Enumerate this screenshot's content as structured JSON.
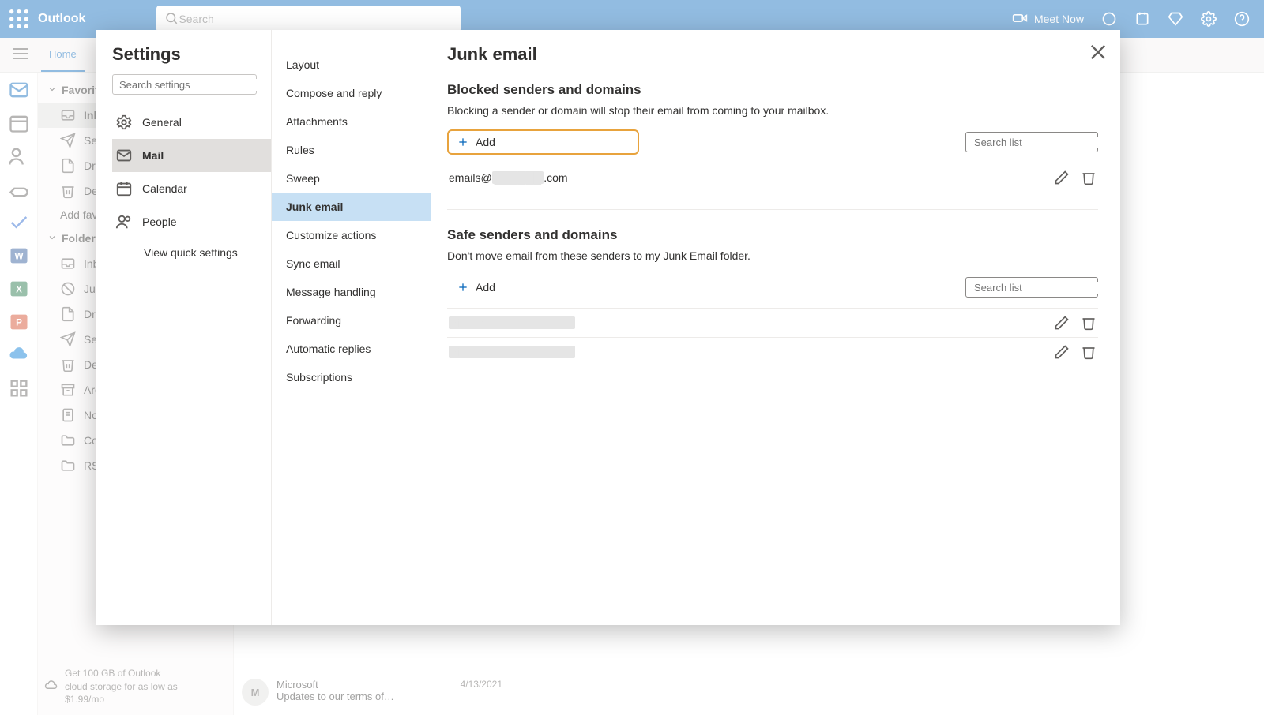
{
  "app": {
    "name": "Outlook"
  },
  "search": {
    "placeholder": "Search"
  },
  "meet": {
    "label": "Meet Now"
  },
  "ribbon": {
    "tabs": [
      "Home"
    ]
  },
  "leftrail": {
    "items": [
      "mail-icon",
      "calendar-icon",
      "people-icon",
      "files-icon",
      "todo-icon",
      "word-icon",
      "excel-icon",
      "powerpoint-icon",
      "onedrive-icon",
      "more-apps-icon"
    ]
  },
  "nav": {
    "sections": {
      "favorites": {
        "label": "Favorites"
      },
      "folders": {
        "label": "Folders"
      }
    },
    "favorites": [
      {
        "name": "inbox",
        "label": "Inbox",
        "icon": "inbox-icon",
        "selected": true
      },
      {
        "name": "sent",
        "label": "Sent Items",
        "icon": "sent-icon"
      },
      {
        "name": "drafts-fav",
        "label": "Drafts",
        "icon": "drafts-icon"
      },
      {
        "name": "deleted-fav",
        "label": "Deleted Items",
        "icon": "trash-icon"
      }
    ],
    "add_favorite": "Add favorite",
    "folders": [
      {
        "name": "inbox-f",
        "label": "Inbox",
        "icon": "inbox-icon"
      },
      {
        "name": "junk",
        "label": "Junk Email",
        "icon": "junk-icon"
      },
      {
        "name": "drafts",
        "label": "Drafts",
        "icon": "drafts-icon"
      },
      {
        "name": "sent-f",
        "label": "Sent Items",
        "icon": "sent-icon"
      },
      {
        "name": "deleted",
        "label": "Deleted Items",
        "icon": "trash-icon"
      },
      {
        "name": "archive",
        "label": "Archive",
        "icon": "archive-icon"
      },
      {
        "name": "notes",
        "label": "Notes",
        "icon": "notes-icon"
      },
      {
        "name": "conv",
        "label": "Conversation History",
        "icon": "folder-icon"
      },
      {
        "name": "feeds",
        "label": "RSS Feeds",
        "icon": "folder-icon"
      }
    ]
  },
  "storage_pitch": {
    "line1": "Get 100 GB of Outlook",
    "line2": "cloud storage for as low as",
    "line3": "$1.99/mo"
  },
  "maillist_peek": {
    "from": "Microsoft",
    "subject": "Updates to our terms of…",
    "date": "4/13/2021",
    "initial": "M"
  },
  "dialog": {
    "settings_title": "Settings",
    "search_settings_placeholder": "Search settings",
    "settings_items": [
      {
        "name": "general",
        "label": "General",
        "icon": "gear-icon"
      },
      {
        "name": "mail",
        "label": "Mail",
        "icon": "mail-icon",
        "selected": true
      },
      {
        "name": "calendar",
        "label": "Calendar",
        "icon": "calendar-icon"
      },
      {
        "name": "people",
        "label": "People",
        "icon": "people-icon"
      }
    ],
    "view_quick": "View quick settings",
    "sub_items": [
      "Layout",
      "Compose and reply",
      "Attachments",
      "Rules",
      "Sweep",
      "Junk email",
      "Customize actions",
      "Sync email",
      "Message handling",
      "Forwarding",
      "Automatic replies",
      "Subscriptions"
    ],
    "sub_selected": "Junk email",
    "pane_title": "Junk email",
    "blocked": {
      "heading": "Blocked senders and domains",
      "desc": "Blocking a sender or domain will stop their email from coming to your mailbox.",
      "add": "Add",
      "search_placeholder": "Search list",
      "entries": [
        {
          "prefix": "emails@",
          "redacted": "██████",
          "suffix": ".com"
        }
      ]
    },
    "safe": {
      "heading": "Safe senders and domains",
      "desc": "Don't move email from these senders to my Junk Email folder.",
      "add": "Add",
      "search_placeholder": "Search list",
      "entries": [
        {
          "redacted_only": true
        },
        {
          "redacted_only": true
        }
      ]
    }
  }
}
